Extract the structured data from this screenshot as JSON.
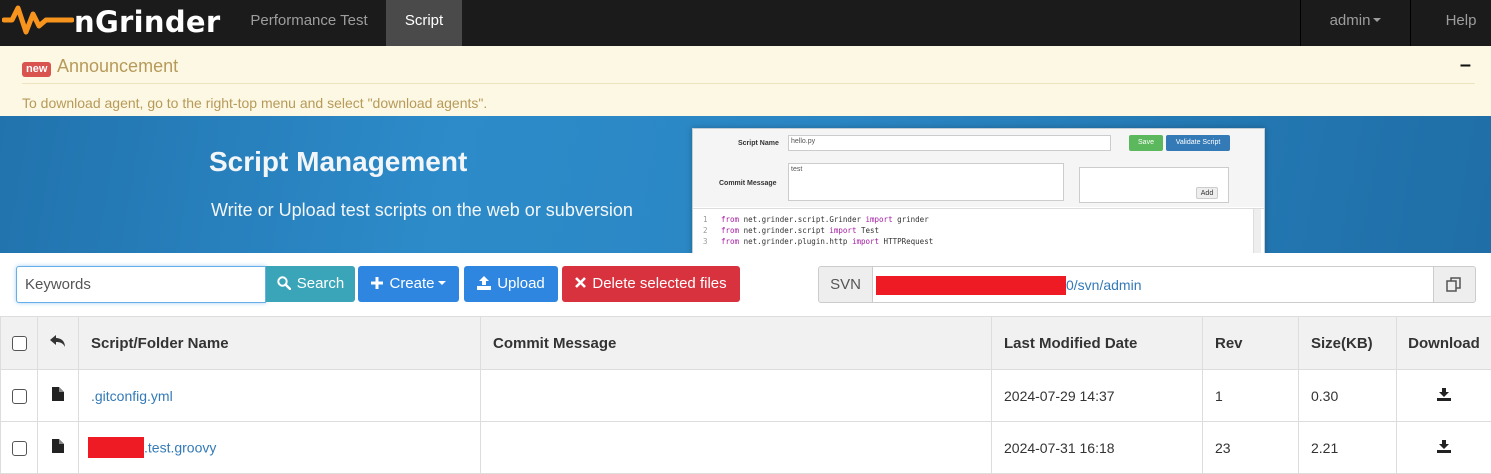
{
  "nav": {
    "brand": "nGrinder",
    "performance_test": "Performance Test",
    "script": "Script",
    "admin": "admin",
    "help": "Help"
  },
  "announcement": {
    "badge": "new",
    "title": "Announcement",
    "toggle": "–",
    "body": "To download agent, go to the right-top menu and select \"download agents\"."
  },
  "banner": {
    "title": "Script Management",
    "subtitle": "Write or Upload test scripts on the web or subversion",
    "preview": {
      "script_name_label": "Script Name",
      "script_name_value": "hello.py",
      "commit_message_label": "Commit Message",
      "commit_message_value": "test",
      "save_button": "Save",
      "validate_button": "Validate Script",
      "add_button": "Add",
      "code_lines": [
        {
          "n": "1",
          "a": "from",
          "b": " net.grinder.script.Grinder ",
          "c": "import",
          "d": " grinder"
        },
        {
          "n": "2",
          "a": "from",
          "b": " net.grinder.script ",
          "c": "import",
          "d": " Test"
        },
        {
          "n": "3",
          "a": "from",
          "b": " net.grinder.plugin.http ",
          "c": "import",
          "d": " HTTPRequest"
        }
      ]
    }
  },
  "toolbar": {
    "search_placeholder": "Keywords",
    "search_button": "Search",
    "create_button": "Create",
    "upload_button": "Upload",
    "delete_button": "Delete selected files",
    "svn_label": "SVN",
    "svn_url_suffix": "0/svn/admin"
  },
  "table": {
    "headers": {
      "name": "Script/Folder Name",
      "commit": "Commit Message",
      "date": "Last Modified Date",
      "rev": "Rev",
      "size": "Size(KB)",
      "download": "Download"
    },
    "rows": [
      {
        "name": ".gitconfig.yml",
        "commit": "",
        "date": "2024-07-29 14:37",
        "rev": "1",
        "size": "0.30",
        "redacted_prefix": false
      },
      {
        "name": ".test.groovy",
        "commit": "",
        "date": "2024-07-31 16:18",
        "rev": "23",
        "size": "2.21",
        "redacted_prefix": true
      }
    ]
  },
  "colors": {
    "navbar": "#1b1b1b",
    "announcement_bg": "#fcf8e3",
    "search_btn": "#3aa5b8",
    "primary_btn": "#2f86e0",
    "danger_btn": "#d9323f",
    "link": "#337ab7",
    "redaction": "#ee1b24"
  }
}
